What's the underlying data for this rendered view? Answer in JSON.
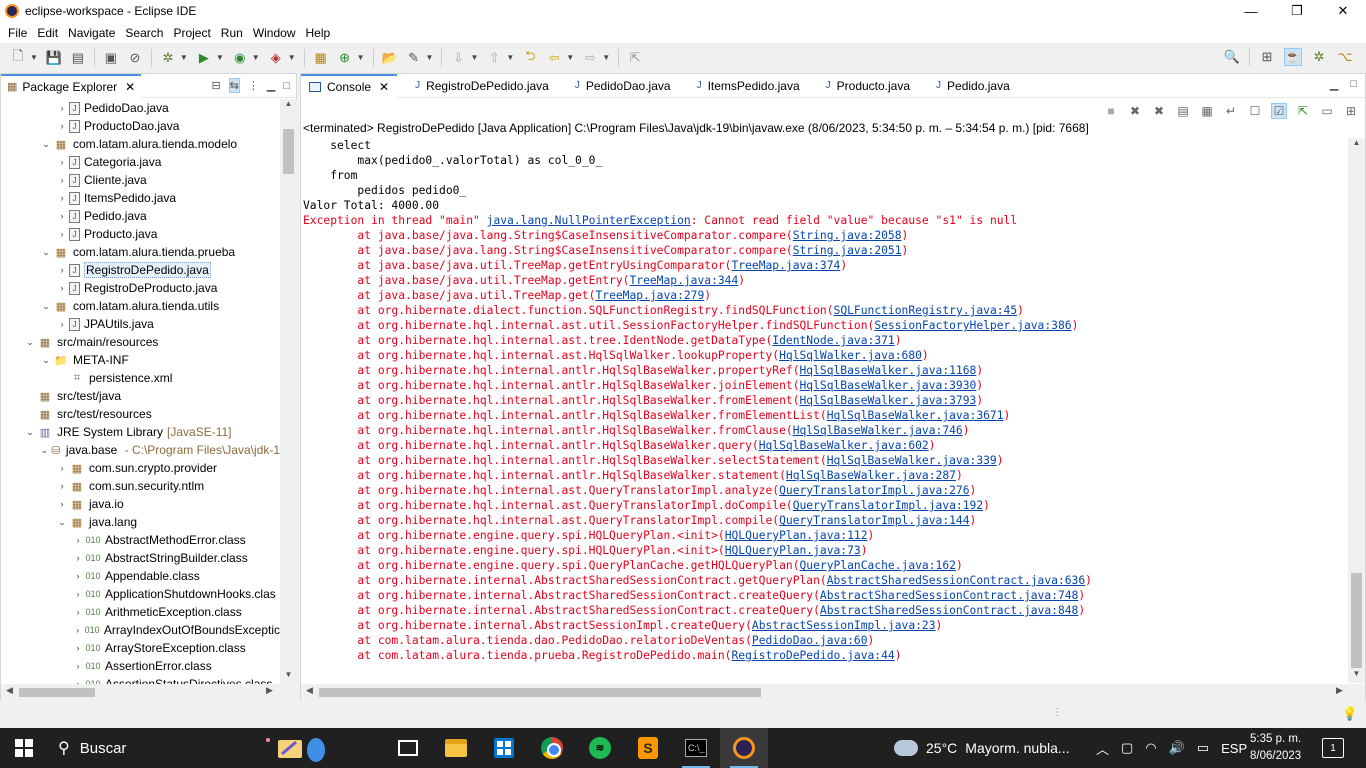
{
  "window": {
    "title": "eclipse-workspace - Eclipse IDE",
    "controls": [
      "—",
      "❐",
      "✕"
    ]
  },
  "menu": [
    "File",
    "Edit",
    "Navigate",
    "Search",
    "Project",
    "Run",
    "Window",
    "Help"
  ],
  "left_panel": {
    "tab_label": "Package Explorer",
    "tree": [
      {
        "indent": 3,
        "twisty": "›",
        "icon": "java",
        "label": "PedidoDao.java"
      },
      {
        "indent": 3,
        "twisty": "›",
        "icon": "java",
        "label": "ProductoDao.java"
      },
      {
        "indent": 2,
        "twisty": "⌄",
        "icon": "pkg",
        "label": "com.latam.alura.tienda.modelo"
      },
      {
        "indent": 3,
        "twisty": "›",
        "icon": "java",
        "label": "Categoria.java"
      },
      {
        "indent": 3,
        "twisty": "›",
        "icon": "java",
        "label": "Cliente.java"
      },
      {
        "indent": 3,
        "twisty": "›",
        "icon": "java",
        "label": "ItemsPedido.java"
      },
      {
        "indent": 3,
        "twisty": "›",
        "icon": "java",
        "label": "Pedido.java"
      },
      {
        "indent": 3,
        "twisty": "›",
        "icon": "java",
        "label": "Producto.java"
      },
      {
        "indent": 2,
        "twisty": "⌄",
        "icon": "pkg",
        "label": "com.latam.alura.tienda.prueba"
      },
      {
        "indent": 3,
        "twisty": "›",
        "icon": "java",
        "label": "RegistroDePedido.java",
        "selected": true
      },
      {
        "indent": 3,
        "twisty": "›",
        "icon": "java",
        "label": "RegistroDeProducto.java"
      },
      {
        "indent": 2,
        "twisty": "⌄",
        "icon": "pkg",
        "label": "com.latam.alura.tienda.utils"
      },
      {
        "indent": 3,
        "twisty": "›",
        "icon": "java",
        "label": "JPAUtils.java"
      },
      {
        "indent": 1,
        "twisty": "⌄",
        "icon": "srcfolder",
        "label": "src/main/resources"
      },
      {
        "indent": 2,
        "twisty": "⌄",
        "icon": "folder",
        "label": "META-INF"
      },
      {
        "indent": 3,
        "twisty": "",
        "icon": "xml",
        "label": "persistence.xml"
      },
      {
        "indent": 1,
        "twisty": "",
        "icon": "srcfolder",
        "label": "src/test/java"
      },
      {
        "indent": 1,
        "twisty": "",
        "icon": "srcfolder",
        "label": "src/test/resources"
      },
      {
        "indent": 1,
        "twisty": "⌄",
        "icon": "lib",
        "label": "JRE System Library",
        "decor": "[JavaSE-11]"
      },
      {
        "indent": 2,
        "twisty": "⌄",
        "icon": "jar",
        "label": "java.base",
        "decor": " - C:\\Program Files\\Java\\jdk-1"
      },
      {
        "indent": 3,
        "twisty": "›",
        "icon": "pkg",
        "label": "com.sun.crypto.provider"
      },
      {
        "indent": 3,
        "twisty": "›",
        "icon": "pkg",
        "label": "com.sun.security.ntlm"
      },
      {
        "indent": 3,
        "twisty": "›",
        "icon": "pkg",
        "label": "java.io"
      },
      {
        "indent": 3,
        "twisty": "⌄",
        "icon": "pkg",
        "label": "java.lang"
      },
      {
        "indent": 4,
        "twisty": "›",
        "icon": "class",
        "label": "AbstractMethodError.class"
      },
      {
        "indent": 4,
        "twisty": "›",
        "icon": "class",
        "label": "AbstractStringBuilder.class"
      },
      {
        "indent": 4,
        "twisty": "›",
        "icon": "class",
        "label": "Appendable.class"
      },
      {
        "indent": 4,
        "twisty": "›",
        "icon": "class",
        "label": "ApplicationShutdownHooks.clas"
      },
      {
        "indent": 4,
        "twisty": "›",
        "icon": "class",
        "label": "ArithmeticException.class"
      },
      {
        "indent": 4,
        "twisty": "›",
        "icon": "class",
        "label": "ArrayIndexOutOfBoundsExceptic"
      },
      {
        "indent": 4,
        "twisty": "›",
        "icon": "class",
        "label": "ArrayStoreException.class"
      },
      {
        "indent": 4,
        "twisty": "›",
        "icon": "class",
        "label": "AssertionError.class"
      },
      {
        "indent": 4,
        "twisty": "›",
        "icon": "class",
        "label": "AssertionStatusDirectives.class"
      }
    ]
  },
  "editor_tabs": [
    {
      "label": "Console",
      "icon": "console",
      "active": true
    },
    {
      "label": "RegistroDePedido.java",
      "icon": "java"
    },
    {
      "label": "PedidoDao.java",
      "icon": "java"
    },
    {
      "label": "ItemsPedido.java",
      "icon": "java"
    },
    {
      "label": "Producto.java",
      "icon": "java"
    },
    {
      "label": "Pedido.java",
      "icon": "java"
    }
  ],
  "console": {
    "terminated_label": "<terminated> RegistroDePedido [Java Application] C:\\Program Files\\Java\\jdk-19\\bin\\javaw.exe  (8/06/2023, 5:34:50 p. m. – 5:34:54 p. m.) [pid: 7668]",
    "lines": [
      {
        "kind": "out",
        "text": "    select"
      },
      {
        "kind": "out",
        "text": "        max(pedido0_.valorTotal) as col_0_0_"
      },
      {
        "kind": "out",
        "text": "    from"
      },
      {
        "kind": "out",
        "text": "        pedidos pedido0_"
      },
      {
        "kind": "out",
        "text": "Valor Total: 4000.00"
      },
      {
        "kind": "err",
        "pre": "Exception in thread \"main\" ",
        "link": "java.lang.NullPointerException",
        "post": ": Cannot read field \"value\" because \"s1\" is null"
      },
      {
        "kind": "err",
        "pre": "\tat java.base/java.lang.String$CaseInsensitiveComparator.compare(",
        "link": "String.java:2058",
        "post": ")"
      },
      {
        "kind": "err",
        "pre": "\tat java.base/java.lang.String$CaseInsensitiveComparator.compare(",
        "link": "String.java:2051",
        "post": ")"
      },
      {
        "kind": "err",
        "pre": "\tat java.base/java.util.TreeMap.getEntryUsingComparator(",
        "link": "TreeMap.java:374",
        "post": ")"
      },
      {
        "kind": "err",
        "pre": "\tat java.base/java.util.TreeMap.getEntry(",
        "link": "TreeMap.java:344",
        "post": ")"
      },
      {
        "kind": "err",
        "pre": "\tat java.base/java.util.TreeMap.get(",
        "link": "TreeMap.java:279",
        "post": ")"
      },
      {
        "kind": "err",
        "pre": "\tat org.hibernate.dialect.function.SQLFunctionRegistry.findSQLFunction(",
        "link": "SQLFunctionRegistry.java:45",
        "post": ")"
      },
      {
        "kind": "err",
        "pre": "\tat org.hibernate.hql.internal.ast.util.SessionFactoryHelper.findSQLFunction(",
        "link": "SessionFactoryHelper.java:386",
        "post": ")"
      },
      {
        "kind": "err",
        "pre": "\tat org.hibernate.hql.internal.ast.tree.IdentNode.getDataType(",
        "link": "IdentNode.java:371",
        "post": ")"
      },
      {
        "kind": "err",
        "pre": "\tat org.hibernate.hql.internal.ast.HqlSqlWalker.lookupProperty(",
        "link": "HqlSqlWalker.java:680",
        "post": ")"
      },
      {
        "kind": "err",
        "pre": "\tat org.hibernate.hql.internal.antlr.HqlSqlBaseWalker.propertyRef(",
        "link": "HqlSqlBaseWalker.java:1168",
        "post": ")"
      },
      {
        "kind": "err",
        "pre": "\tat org.hibernate.hql.internal.antlr.HqlSqlBaseWalker.joinElement(",
        "link": "HqlSqlBaseWalker.java:3930",
        "post": ")"
      },
      {
        "kind": "err",
        "pre": "\tat org.hibernate.hql.internal.antlr.HqlSqlBaseWalker.fromElement(",
        "link": "HqlSqlBaseWalker.java:3793",
        "post": ")"
      },
      {
        "kind": "err",
        "pre": "\tat org.hibernate.hql.internal.antlr.HqlSqlBaseWalker.fromElementList(",
        "link": "HqlSqlBaseWalker.java:3671",
        "post": ")"
      },
      {
        "kind": "err",
        "pre": "\tat org.hibernate.hql.internal.antlr.HqlSqlBaseWalker.fromClause(",
        "link": "HqlSqlBaseWalker.java:746",
        "post": ")"
      },
      {
        "kind": "err",
        "pre": "\tat org.hibernate.hql.internal.antlr.HqlSqlBaseWalker.query(",
        "link": "HqlSqlBaseWalker.java:602",
        "post": ")"
      },
      {
        "kind": "err",
        "pre": "\tat org.hibernate.hql.internal.antlr.HqlSqlBaseWalker.selectStatement(",
        "link": "HqlSqlBaseWalker.java:339",
        "post": ")"
      },
      {
        "kind": "err",
        "pre": "\tat org.hibernate.hql.internal.antlr.HqlSqlBaseWalker.statement(",
        "link": "HqlSqlBaseWalker.java:287",
        "post": ")"
      },
      {
        "kind": "err",
        "pre": "\tat org.hibernate.hql.internal.ast.QueryTranslatorImpl.analyze(",
        "link": "QueryTranslatorImpl.java:276",
        "post": ")"
      },
      {
        "kind": "err",
        "pre": "\tat org.hibernate.hql.internal.ast.QueryTranslatorImpl.doCompile(",
        "link": "QueryTranslatorImpl.java:192",
        "post": ")"
      },
      {
        "kind": "err",
        "pre": "\tat org.hibernate.hql.internal.ast.QueryTranslatorImpl.compile(",
        "link": "QueryTranslatorImpl.java:144",
        "post": ")"
      },
      {
        "kind": "err",
        "pre": "\tat org.hibernate.engine.query.spi.HQLQueryPlan.<init>(",
        "link": "HQLQueryPlan.java:112",
        "post": ")"
      },
      {
        "kind": "err",
        "pre": "\tat org.hibernate.engine.query.spi.HQLQueryPlan.<init>(",
        "link": "HQLQueryPlan.java:73",
        "post": ")"
      },
      {
        "kind": "err",
        "pre": "\tat org.hibernate.engine.query.spi.QueryPlanCache.getHQLQueryPlan(",
        "link": "QueryPlanCache.java:162",
        "post": ")"
      },
      {
        "kind": "err",
        "pre": "\tat org.hibernate.internal.AbstractSharedSessionContract.getQueryPlan(",
        "link": "AbstractSharedSessionContract.java:636",
        "post": ")"
      },
      {
        "kind": "err",
        "pre": "\tat org.hibernate.internal.AbstractSharedSessionContract.createQuery(",
        "link": "AbstractSharedSessionContract.java:748",
        "post": ")"
      },
      {
        "kind": "err",
        "pre": "\tat org.hibernate.internal.AbstractSharedSessionContract.createQuery(",
        "link": "AbstractSharedSessionContract.java:848",
        "post": ")"
      },
      {
        "kind": "err",
        "pre": "\tat org.hibernate.internal.AbstractSessionImpl.createQuery(",
        "link": "AbstractSessionImpl.java:23",
        "post": ")"
      },
      {
        "kind": "err",
        "pre": "\tat com.latam.alura.tienda.dao.PedidoDao.relatorioDeVentas(",
        "link": "PedidoDao.java:60",
        "post": ")"
      },
      {
        "kind": "err",
        "pre": "\tat com.latam.alura.tienda.prueba.RegistroDePedido.main(",
        "link": "RegistroDePedido.java:44",
        "post": ")"
      }
    ]
  },
  "taskbar": {
    "search_placeholder": "Buscar",
    "weather_temp": "25°C",
    "weather_desc": "Mayorm. nubla...",
    "language": "ESP",
    "time": "5:35 p. m.",
    "date": "8/06/2023",
    "notification_count": "1"
  },
  "colors": {
    "error_text": "#e6001d",
    "link": "#0645ad",
    "selection": "#e5f0fb",
    "active_tab_accent": "#4a90e2"
  }
}
